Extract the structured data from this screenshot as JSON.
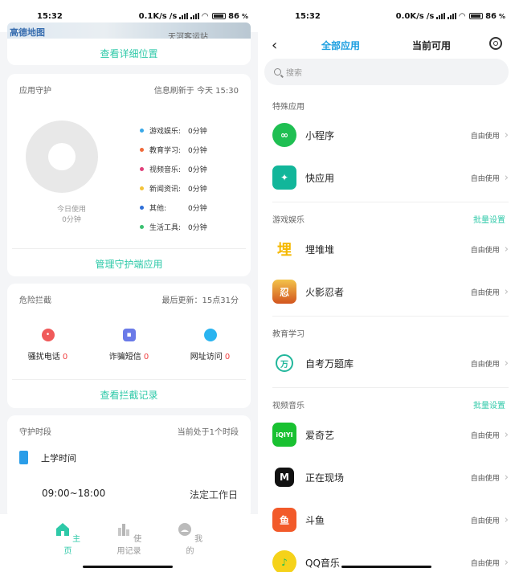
{
  "left": {
    "status": {
      "time": "15:32",
      "network": "0.1K/s",
      "battery": "86"
    },
    "map": {
      "label": "高德地图",
      "place_hint": "天河客运站"
    },
    "location_link": "查看详细位置",
    "app_guard": {
      "title": "应用守护",
      "refresh_text": "信息刷新于 今天 15:30",
      "today_label": "今日使用",
      "today_value": "0分钟",
      "legend": [
        {
          "name": "游戏娱乐:",
          "value": "0分钟",
          "color": "#3aa8e8"
        },
        {
          "name": "教育学习:",
          "value": "0分钟",
          "color": "#f06a3a"
        },
        {
          "name": "视频音乐:",
          "value": "0分钟",
          "color": "#e0407a"
        },
        {
          "name": "新闻资讯:",
          "value": "0分钟",
          "color": "#f3c33a"
        },
        {
          "name": "其他:",
          "value": "0分钟",
          "color": "#2f6fd8"
        },
        {
          "name": "生活工具:",
          "value": "0分钟",
          "color": "#3ac070"
        }
      ],
      "manage_link": "管理守护端应用"
    },
    "risk": {
      "title": "危险拦截",
      "last_update": "最后更新：15点31分",
      "items": [
        {
          "label": "骚扰电话",
          "count": "0",
          "color": "#f05a5a",
          "icon": "phone-icon"
        },
        {
          "label": "诈骗短信",
          "count": "0",
          "color": "#6a7ae8",
          "icon": "message-icon"
        },
        {
          "label": "网址访问",
          "count": "0",
          "color": "#2ab4f0",
          "icon": "web-icon"
        }
      ],
      "record_link": "查看拦截记录"
    },
    "period": {
      "title": "守护时段",
      "current": "当前处于1个时段",
      "name": "上学时间",
      "time": "09:00~18:00",
      "days": "法定工作日"
    },
    "nav": [
      {
        "label": "主页",
        "icon": "home-icon"
      },
      {
        "label": "使用记录",
        "icon": "records-icon"
      },
      {
        "label": "我的",
        "icon": "profile-icon"
      }
    ]
  },
  "right": {
    "status": {
      "time": "15:32",
      "network": "0.0K/s",
      "battery": "86"
    },
    "tabs": {
      "all": "全部应用",
      "current": "当前可用"
    },
    "search_placeholder": "搜索",
    "sections": [
      {
        "title": "特殊应用",
        "batch": ""
      },
      {
        "title": "游戏娱乐",
        "batch": "批量设置"
      },
      {
        "title": "教育学习",
        "batch": ""
      },
      {
        "title": "视频音乐",
        "batch": "批量设置"
      }
    ],
    "apps": [
      {
        "name": "小程序",
        "perm": "自由使用",
        "color": "#1fbf52",
        "icon": "mini-program-icon",
        "glyph": "∞"
      },
      {
        "name": "快应用",
        "perm": "自由使用",
        "color": "#12b69a",
        "icon": "quick-app-icon",
        "glyph": "✦"
      },
      {
        "name": "埋堆堆",
        "perm": "自由使用",
        "color": "#ffd21a",
        "icon": "maiduidui-icon",
        "glyph": "埋"
      },
      {
        "name": "火影忍者",
        "perm": "自由使用",
        "color": "#e86a1a",
        "icon": "naruto-icon",
        "glyph": "忍"
      },
      {
        "name": "自考万题库",
        "perm": "自由使用",
        "color": "#22b79c",
        "icon": "wanti-icon",
        "glyph": "万"
      },
      {
        "name": "爱奇艺",
        "perm": "自由使用",
        "color": "#19c131",
        "icon": "iqiyi-icon",
        "glyph": "iQIYI"
      },
      {
        "name": "正在现场",
        "perm": "自由使用",
        "color": "#111111",
        "icon": "live-icon",
        "glyph": "M"
      },
      {
        "name": "斗鱼",
        "perm": "自由使用",
        "color": "#f25a2a",
        "icon": "douyu-icon",
        "glyph": "鱼"
      },
      {
        "name": "QQ音乐",
        "perm": "自由使用",
        "color": "#f5d21a",
        "icon": "qqmusic-icon",
        "glyph": "♪"
      }
    ]
  }
}
